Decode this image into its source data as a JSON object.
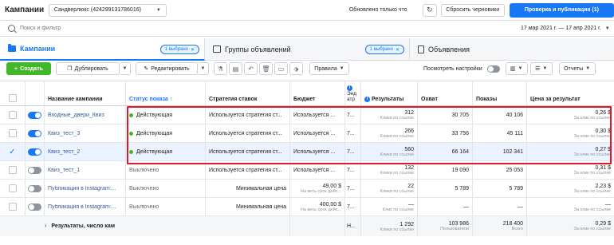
{
  "topbar": {
    "title": "Кампании",
    "account": "Сандверлюкс (424299131786016)",
    "updated": "Обновлено только что",
    "discard_label": "Сбросить черновики",
    "publish_label": "Проверка и публикация (1)"
  },
  "search": {
    "placeholder": "Поиск и фильтр",
    "date_range": "17 мар 2021 г. — 17 апр 2021 г."
  },
  "tabs": [
    {
      "label": "Кампании",
      "pill": "1 выбрано",
      "active": true
    },
    {
      "label": "Группы объявлений",
      "pill": "1 выбрано",
      "active": false
    },
    {
      "label": "Объявления",
      "active": false
    }
  ],
  "toolbar": {
    "create_label": "Создать",
    "duplicate_label": "Дублировать",
    "edit_label": "Редактировать",
    "rules_label": "Правила",
    "view_settings_label": "Посмотреть настройки",
    "reports_label": "Отчеты"
  },
  "table": {
    "headers": {
      "name": "Название кампании",
      "status": "Статус показа",
      "strategy": "Стратегия ставок",
      "budget": "Бюджет",
      "end_line1": "Энд",
      "end_line2": "атр",
      "results": "Результаты",
      "reach": "Охват",
      "impressions": "Показы",
      "cpr": "Цена за результат"
    },
    "rows": [
      {
        "name": "Входные_двери_Квиз",
        "status": "Действующая",
        "active": true,
        "selected": false,
        "checked": false,
        "strategy": "Используется стратегия ст...",
        "budget": "Используется ...",
        "end": "7...",
        "results": "312",
        "results_sub": "Клики по ссылке",
        "reach": "30 705",
        "impressions": "40 106",
        "cpr": "0,26 $",
        "cpr_sub": "За клик по ссылке"
      },
      {
        "name": "Квиз_тест_3",
        "status": "Действующая",
        "active": true,
        "selected": false,
        "checked": false,
        "strategy": "Используется стратегия ст...",
        "budget": "Используется ...",
        "end": "7...",
        "results": "266",
        "results_sub": "Клики по ссылке",
        "reach": "33 756",
        "impressions": "45 111",
        "cpr": "0,30 $",
        "cpr_sub": "За клик по ссылке"
      },
      {
        "name": "Квиз_тест_2",
        "status": "Действующая",
        "active": true,
        "selected": true,
        "checked": true,
        "strategy": "Используется стратегия ст...",
        "budget": "Используется ...",
        "end": "7...",
        "results": "560",
        "results_sub": "Клики по ссылке",
        "reach": "66 164",
        "impressions": "102 341",
        "cpr": "0,27 $",
        "cpr_sub": "За клик по ссылке"
      },
      {
        "name": "Квиз_тест_1",
        "status": "Выключено",
        "active": false,
        "selected": false,
        "checked": false,
        "strategy": "Используется стратегия ст...",
        "budget": "Используется ...",
        "end": "7...",
        "results": "132",
        "results_sub": "Клики по ссылке",
        "reach": "19 090",
        "impressions": "25 053",
        "cpr": "0,31 $",
        "cpr_sub": "За клик по ссылке"
      },
      {
        "name": "Публикация в Instagram:...",
        "status": "Выключено",
        "active": false,
        "selected": false,
        "checked": false,
        "strategy": "Минимальная цена",
        "strategy_right": true,
        "budget": "49,00 $",
        "budget_sub": "На весь срок дейс...",
        "end": "7...",
        "results": "22",
        "results_sub": "Клики по ссылке",
        "reach": "5 789",
        "impressions": "5 789",
        "cpr": "2,23 $",
        "cpr_sub": "За клик по ссылке"
      },
      {
        "name": "Публикация в Instagram:...",
        "status": "Выключено",
        "active": false,
        "selected": false,
        "checked": false,
        "strategy": "Минимальная цена",
        "strategy_right": true,
        "budget": "400,00 $",
        "budget_sub": "На весь срок дейс...",
        "end": "7...",
        "results": "—",
        "results_sub": "Клик по ссылке",
        "reach": "—",
        "impressions": "—",
        "cpr": "—",
        "cpr_sub": "За клик по ссылке"
      }
    ],
    "footer": {
      "label": "Результаты, число кам",
      "end": "Н...",
      "results": "1 292",
      "results_sub": "Клики по ссылке",
      "reach": "103 986",
      "reach_sub": "Пользователи",
      "impressions": "218 400",
      "impressions_sub": "Всего",
      "cpr": "0,29 $",
      "cpr_sub": "За клик по ссылке"
    }
  }
}
